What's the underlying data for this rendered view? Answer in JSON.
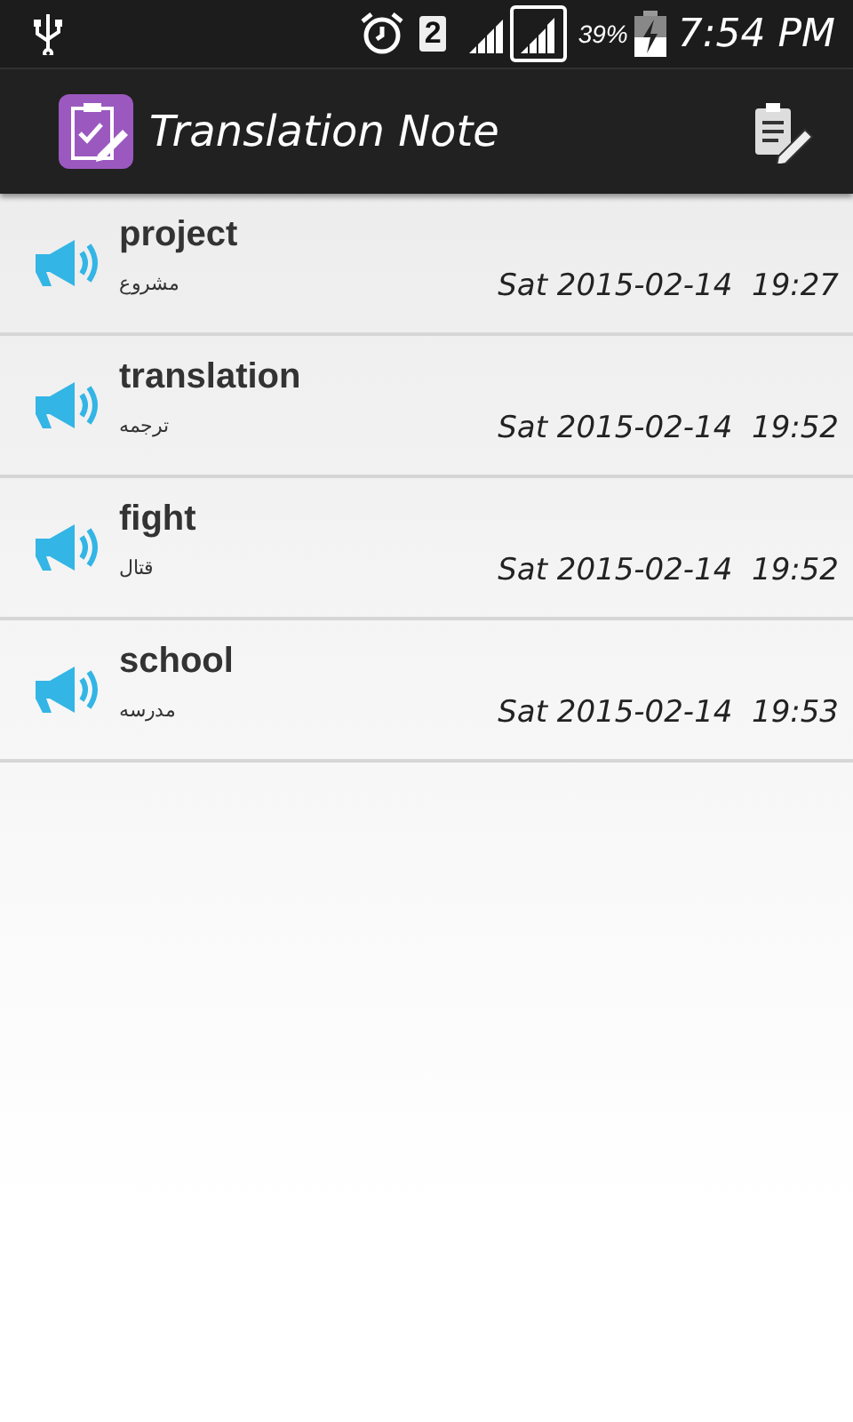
{
  "status_bar": {
    "sim_badge": "2",
    "battery_percent": "39%",
    "time": "7:54 PM"
  },
  "app_bar": {
    "title": "Translation Note"
  },
  "notes": [
    {
      "word": "project",
      "translation": "مشروع",
      "date": "Sat 2015-02-14  19:27"
    },
    {
      "word": "translation",
      "translation": "ترجمه",
      "date": "Sat 2015-02-14  19:52"
    },
    {
      "word": "fight",
      "translation": "قتال",
      "date": "Sat 2015-02-14  19:52"
    },
    {
      "word": "school",
      "translation": "مدرسه",
      "date": "Sat 2015-02-14  19:53"
    }
  ]
}
